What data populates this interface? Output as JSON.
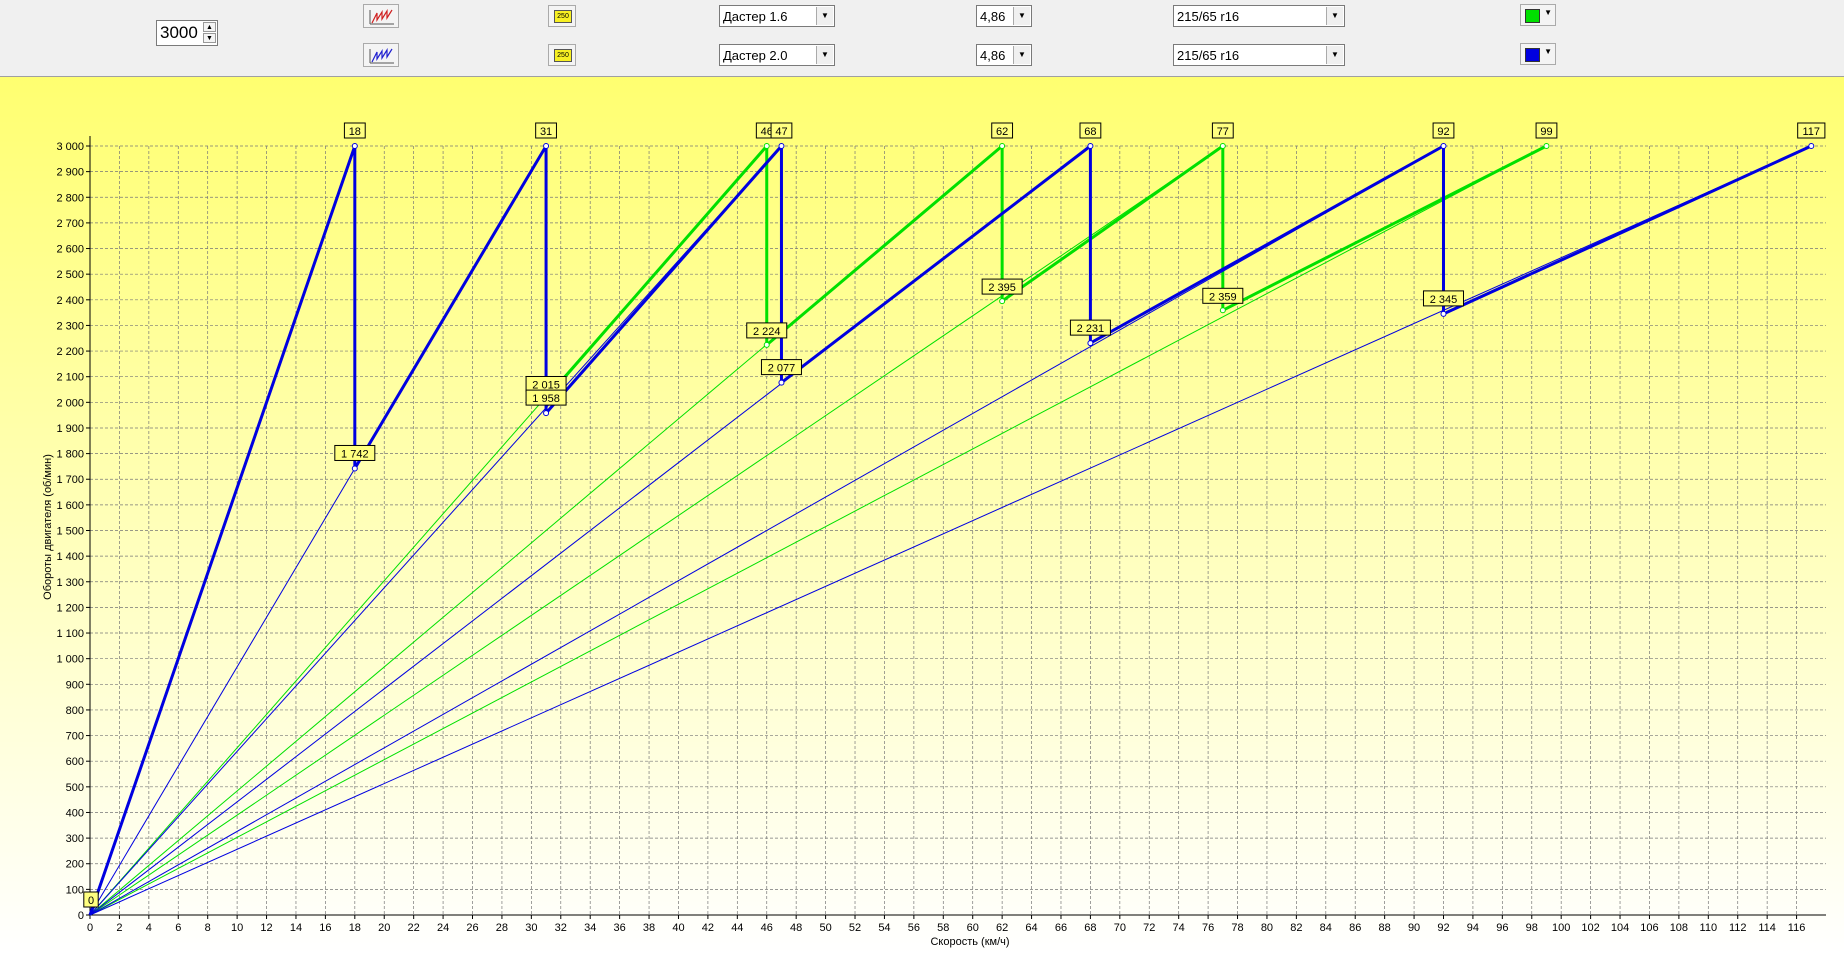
{
  "toolbar": {
    "rpm_value": "3000",
    "rows": [
      {
        "profile": "Дастер 1.6",
        "ratio": "4,86",
        "tire": "215/65 r16",
        "color": "#00e000",
        "badge": "250"
      },
      {
        "profile": "Дастер 2.0",
        "ratio": "4,86",
        "tire": "215/65 r16",
        "color": "#0000e0",
        "badge": "250"
      }
    ],
    "spin_up": "▲",
    "spin_down": "▼",
    "dropdown_arrow": "▼"
  },
  "chart_data": {
    "type": "line",
    "xlabel": "Скорость (км/ч)",
    "ylabel": "Обороты двигателя (об/мин)",
    "xlim": [
      0,
      118
    ],
    "ylim": [
      0,
      3000
    ],
    "x_ticks_step": 2,
    "y_ticks_step": 100,
    "grid": true,
    "background": [
      "#ffff70",
      "#ffffff"
    ],
    "origin_label": "0",
    "series": [
      {
        "name": "Дастер 1.6",
        "color": "#00e000",
        "gear_tops": [
          46,
          62,
          77,
          99
        ],
        "shift_points": [
          {
            "x": 31,
            "y": 2015
          },
          {
            "x": 46,
            "y": 2224
          },
          {
            "x": 62,
            "y": 2395
          },
          {
            "x": 77,
            "y": 2359
          }
        ],
        "labels_top": [
          "46",
          "62",
          "77",
          "99"
        ],
        "labels_shift": [
          "2 015",
          "2 224",
          "2 395",
          "2 359"
        ]
      },
      {
        "name": "Дастер 2.0",
        "color": "#0000e0",
        "gear_tops": [
          18,
          31,
          47,
          68,
          92,
          117
        ],
        "shift_points": [
          {
            "x": 18,
            "y": 1742
          },
          {
            "x": 31,
            "y": 1958
          },
          {
            "x": 47,
            "y": 2077
          },
          {
            "x": 68,
            "y": 2231
          },
          {
            "x": 92,
            "y": 2345
          }
        ],
        "labels_top": [
          "18",
          "31",
          "47",
          "68",
          "92",
          "117"
        ],
        "labels_shift": [
          "1 742",
          "1 958",
          "2 077",
          "2 231",
          "2 345"
        ]
      }
    ]
  }
}
